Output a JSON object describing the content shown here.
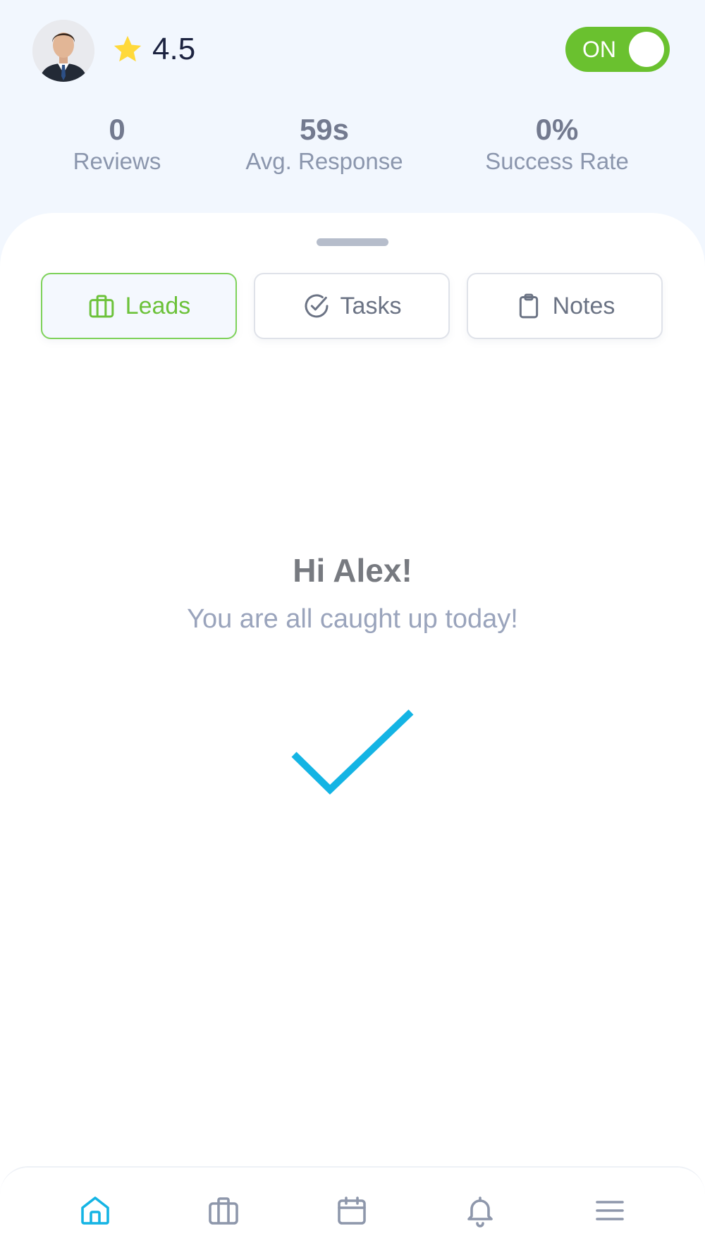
{
  "header": {
    "rating": "4.5",
    "status_toggle": {
      "label": "ON",
      "on": true
    },
    "stats": [
      {
        "value": "0",
        "label": "Reviews"
      },
      {
        "value": "59s",
        "label": "Avg. Response"
      },
      {
        "value": "0%",
        "label": "Success Rate"
      }
    ]
  },
  "tabs": [
    {
      "label": "Leads",
      "icon": "briefcase-icon",
      "active": true
    },
    {
      "label": "Tasks",
      "icon": "check-circle-icon",
      "active": false
    },
    {
      "label": "Notes",
      "icon": "clipboard-icon",
      "active": false
    }
  ],
  "empty_state": {
    "greeting": "Hi Alex!",
    "message": "You are all caught up today!",
    "icon": "checkmark-icon"
  },
  "bottom_nav": [
    {
      "icon": "home-icon",
      "active": true
    },
    {
      "icon": "briefcase-icon",
      "active": false
    },
    {
      "icon": "calendar-icon",
      "active": false
    },
    {
      "icon": "bell-icon",
      "active": false
    },
    {
      "icon": "menu-icon",
      "active": false
    }
  ],
  "colors": {
    "accent_green": "#6ac12f",
    "accent_blue": "#14b4e4",
    "star_yellow": "#ffd93b",
    "background": "#f2f7fe"
  }
}
